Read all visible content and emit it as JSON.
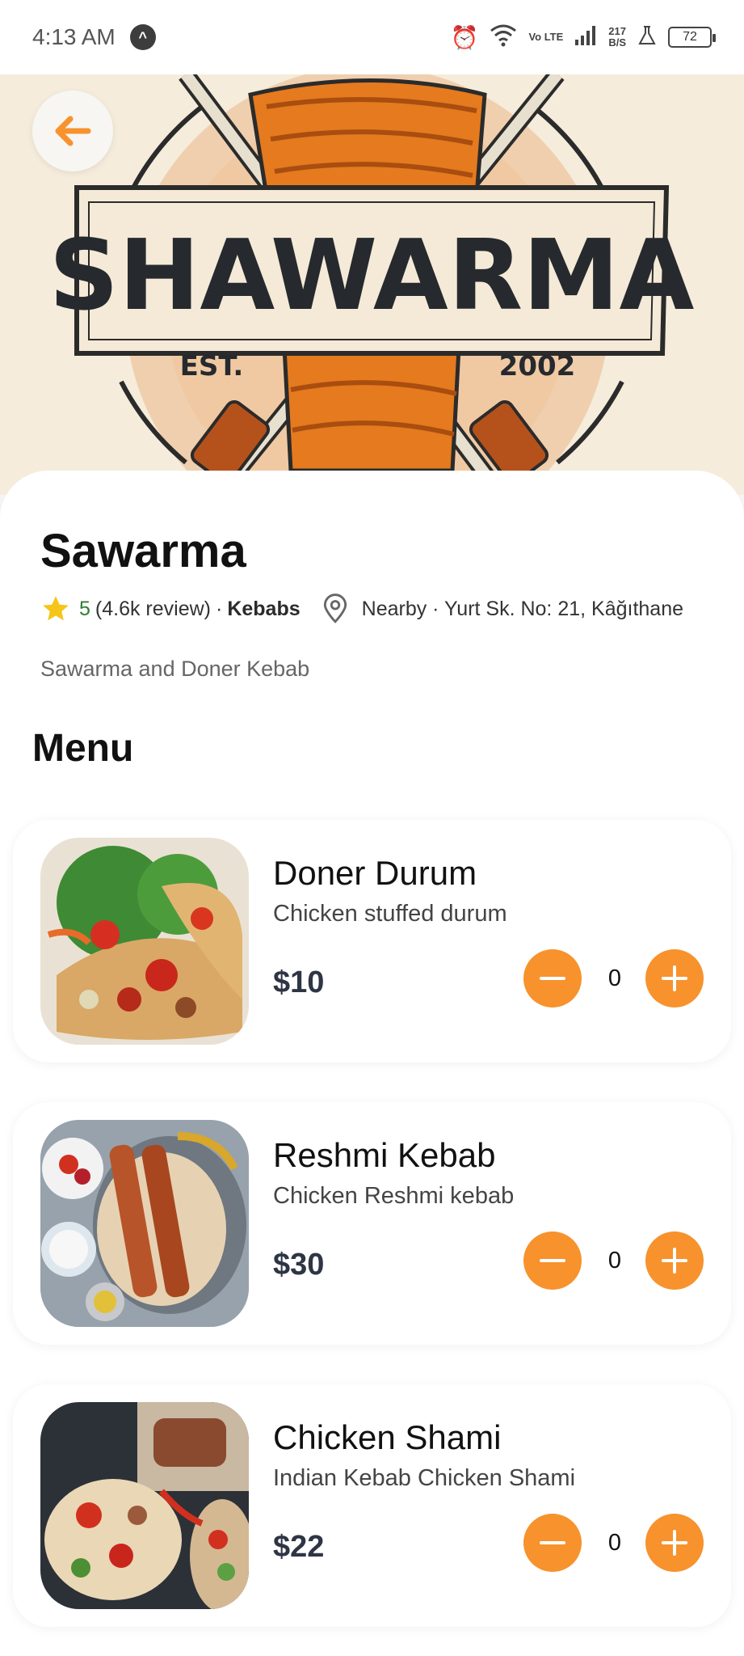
{
  "status_bar": {
    "time": "4:13 AM",
    "nav_glyph": "^",
    "volte": "Vo LTE",
    "net_speed_value": "217",
    "net_speed_unit": "B/S",
    "battery": "72"
  },
  "hero": {
    "logo_title": "SHAWARMA",
    "logo_est": "EST.",
    "logo_year": "2002"
  },
  "restaurant": {
    "name": "Sawarma",
    "rating": "5",
    "reviews": "(4.6k review)",
    "separator": "·",
    "category": "Kebabs",
    "location": "Nearby · Yurt Sk. No: 21,  Kâğıthane",
    "description": "Sawarma and Doner Kebab"
  },
  "menu": {
    "heading": "Menu",
    "items": [
      {
        "name": "Doner Durum",
        "description": "Chicken stuffed durum",
        "price": "$10",
        "quantity": "0"
      },
      {
        "name": "Reshmi Kebab",
        "description": "Chicken Reshmi kebab",
        "price": "$30",
        "quantity": "0"
      },
      {
        "name": "Chicken Shami",
        "description": "Indian Kebab Chicken Shami",
        "price": "$22",
        "quantity": "0"
      }
    ]
  },
  "colors": {
    "accent": "#f7922d",
    "rating_green": "#2e7d32",
    "hero_bg": "#f5ecdb"
  },
  "icons": {
    "back": "arrow-left-icon",
    "star": "star-icon",
    "location": "map-pin-icon",
    "minus": "minus-icon",
    "plus": "plus-icon"
  }
}
